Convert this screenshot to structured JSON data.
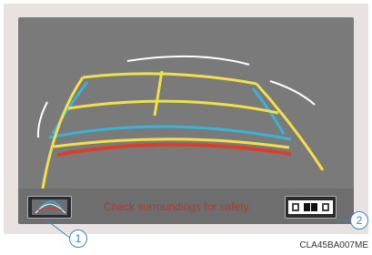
{
  "screen": {
    "warning_text": "Check surroundings for safety.",
    "colors": {
      "background": "#7a7a7a",
      "frame": "#e8e3e0",
      "guide_yellow": "#f2e04b",
      "guide_blue": "#3bb3d9",
      "guide_red": "#d8402c",
      "warning_red": "#b33a2c"
    }
  },
  "buttons": {
    "guide_switch_icon": "parking-guide-icon",
    "view_switch_icon": "view-mode-icon"
  },
  "callouts": {
    "one": "1",
    "two": "2"
  },
  "figure_code": "CLA45BA007ME"
}
